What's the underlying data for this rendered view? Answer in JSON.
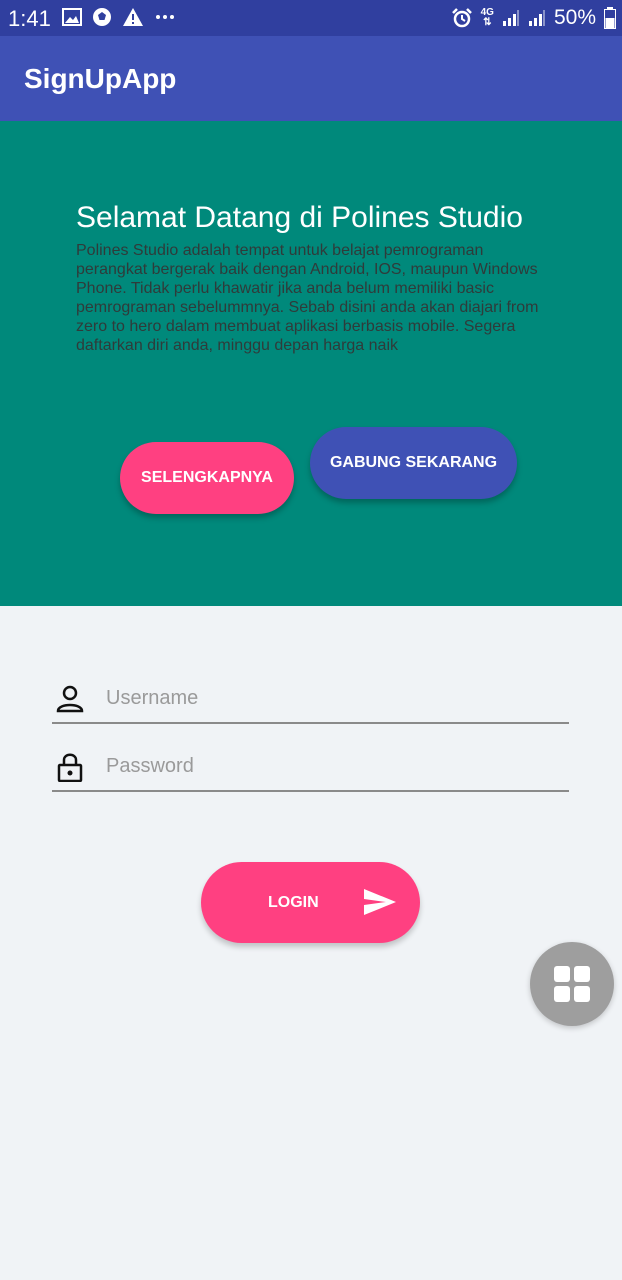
{
  "status_bar": {
    "time": "1:41",
    "network": "4G",
    "battery": "50%",
    "icons": [
      "image-icon",
      "ball-icon",
      "warning-icon",
      "more-icon",
      "alarm-icon",
      "network-4g-icon",
      "signal-icon",
      "signal-icon",
      "battery-icon"
    ]
  },
  "app_bar": {
    "title": "SignUpApp"
  },
  "hero": {
    "title": "Selamat Datang di Polines Studio",
    "description": "Polines Studio adalah tempat untuk belajat pemrograman perangkat bergerak baik dengan Android, IOS, maupun Windows Phone. Tidak perlu khawatir jika anda belum memiliki basic pemrograman sebelummnya. Sebab disini anda akan diajari from zero to hero dalam membuat aplikasi berbasis mobile. Segera daftarkan diri anda, minggu depan harga naik",
    "more_button": "SELENGKAPNYA",
    "join_button": "GABUNG SEKARANG"
  },
  "login": {
    "username_placeholder": "Username",
    "username_value": "",
    "password_placeholder": "Password",
    "password_value": "",
    "login_button": "LOGIN"
  },
  "colors": {
    "status_bar": "#303f9f",
    "app_bar": "#3f51b5",
    "hero": "#00897b",
    "accent": "#ff4081",
    "fab": "#9e9e9e",
    "background": "#f0f3f6"
  }
}
